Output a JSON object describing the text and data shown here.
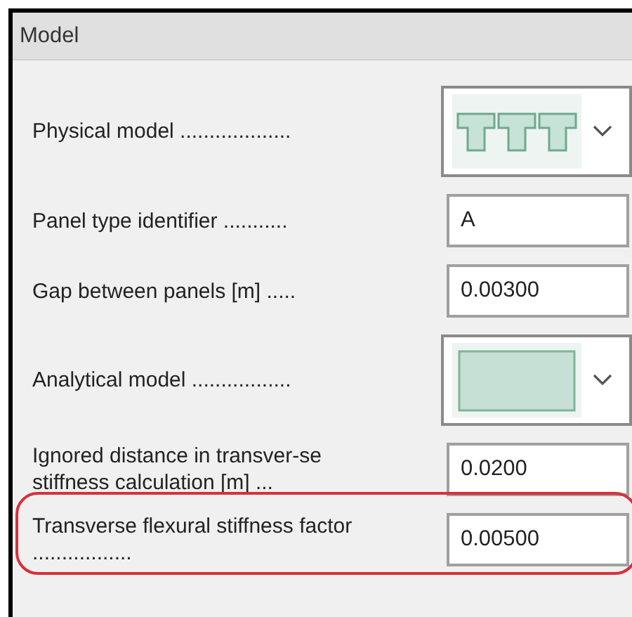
{
  "panel": {
    "title": "Model"
  },
  "rows": [
    {
      "kind": "beam-combo",
      "label": "Physical model ...................",
      "highlighted": false
    },
    {
      "kind": "field",
      "label": "Panel type identifier ...........",
      "value": "A",
      "highlighted": false
    },
    {
      "kind": "field",
      "label": "Gap between panels [m] .....",
      "value": "0.00300",
      "highlighted": false
    },
    {
      "kind": "block-combo",
      "label": "Analytical model .................",
      "highlighted": false
    },
    {
      "kind": "field",
      "label": "Ignored distance in transver-se stiffness calculation [m] ...",
      "value": "0.0200",
      "highlighted": false
    },
    {
      "kind": "field",
      "label": "Transverse flexural stiffness factor .................",
      "value": "0.00500",
      "highlighted": true
    }
  ]
}
